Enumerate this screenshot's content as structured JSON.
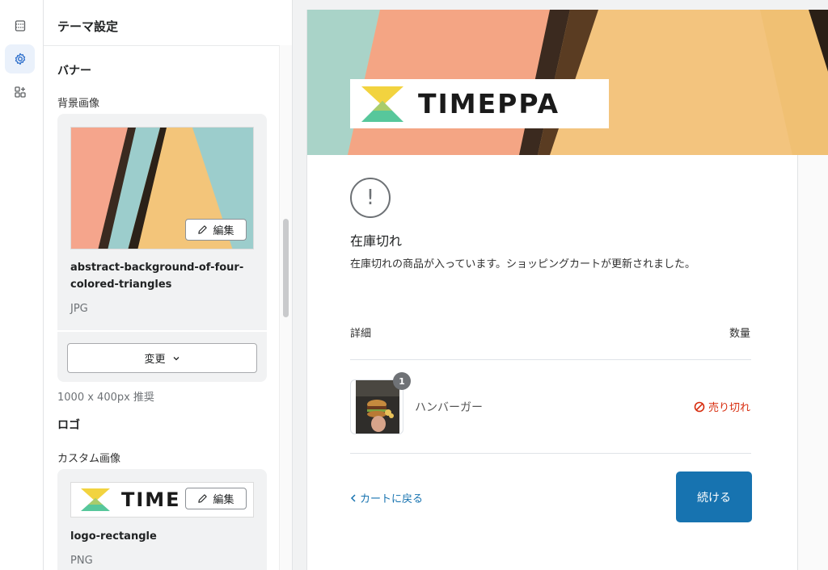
{
  "sidebar": {
    "title": "テーマ設定",
    "banner": {
      "heading": "バナー",
      "bg_label": "背景画像",
      "file_name": "abstract-background-of-four-colored-triangles",
      "file_type": "JPG",
      "edit_label": "編集",
      "change_label": "変更",
      "hint": "1000 x 400px 推奨"
    },
    "logo": {
      "heading": "ロゴ",
      "custom_label": "カスタム画像",
      "preview_text": "TIME",
      "file_name": "logo-rectangle",
      "file_type": "PNG",
      "edit_label": "編集"
    }
  },
  "preview": {
    "logo_text": "TIMEPPA",
    "title": "在庫切れ",
    "description": "在庫切れの商品が入っています。ショッピングカートが更新されました。",
    "col_detail": "詳細",
    "col_qty": "数量",
    "item": {
      "name": "ハンバーガー",
      "quantity": "1",
      "status": "売り切れ"
    },
    "back_label": "カートに戻る",
    "continue_label": "続ける"
  },
  "colors": {
    "accent": "#1773b0",
    "danger": "#d72c0d"
  }
}
